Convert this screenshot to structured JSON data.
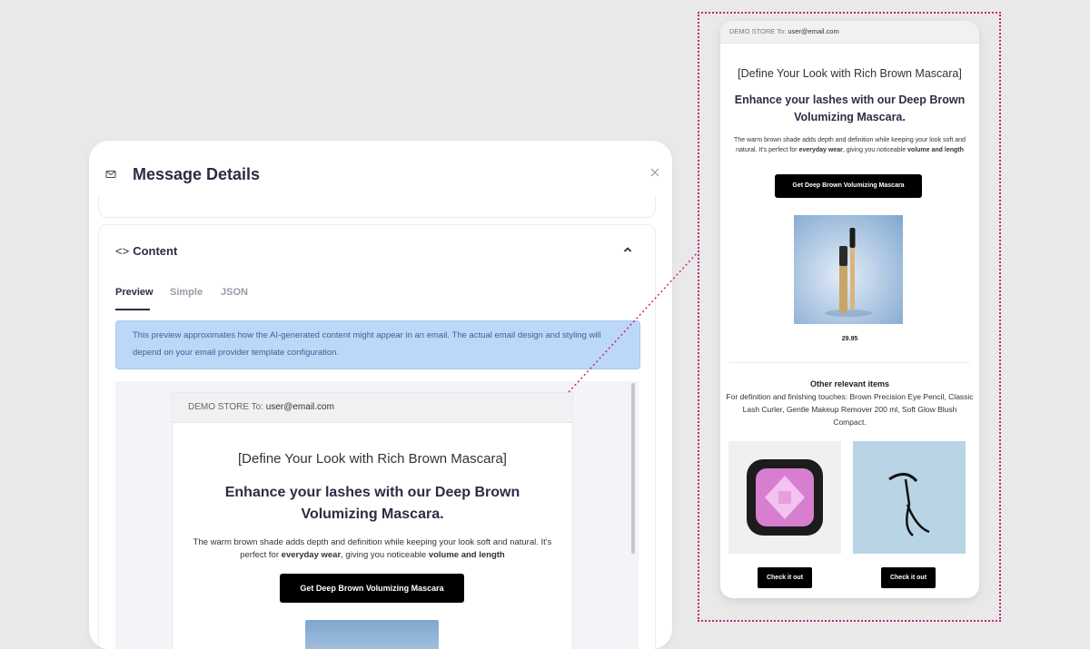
{
  "panel": {
    "title": "Message Details",
    "icons": {
      "header": "envelope-icon",
      "close": "close-icon",
      "collapse": "chevron-up-icon",
      "section": "code-icon"
    }
  },
  "content_section": {
    "title": "Content",
    "tabs": [
      {
        "label": "Preview",
        "active": true
      },
      {
        "label": "Simple",
        "active": false
      },
      {
        "label": "JSON",
        "active": false
      }
    ],
    "info_text": "This preview approximates how the AI-generated content might appear in an email. The actual email design and styling will depend on your email provider template configuration."
  },
  "email": {
    "from_label": "DEMO STORE To: ",
    "to_address": "user@email.com",
    "subject": "[Define Your Look with Rich Brown Mascara]",
    "headline": "Enhance your lashes with our Deep Brown Volumizing Mascara.",
    "body_parts": {
      "p1": "The warm brown shade adds depth and definition while keeping your look soft and natural. It's perfect for ",
      "b1": "everyday wear",
      "p2": ", giving you noticeable ",
      "b2": "volume and length"
    },
    "cta_label": "Get Deep Brown Volumizing Mascara",
    "hero_product": {
      "image": "mascara-product-image",
      "price": "29.95"
    },
    "other_title": "Other relevant items",
    "other_text": "For definition and finishing touches: Brown Precision Eye Pencil, Classic Lash Curler, Gentle Makeup Remover 200 ml, Soft Glow Blush Compact.",
    "related": [
      {
        "image": "blush-compact-image",
        "cta": "Check it out"
      },
      {
        "image": "lash-curler-image",
        "cta": "Check it out"
      }
    ]
  },
  "colors": {
    "background": "#e9e9e9",
    "accent_text": "#2f2b45",
    "info_bg": "#bcd8f8",
    "info_text": "#3f5f96",
    "zoom_border": "#c0287a",
    "button_bg": "#000000"
  }
}
